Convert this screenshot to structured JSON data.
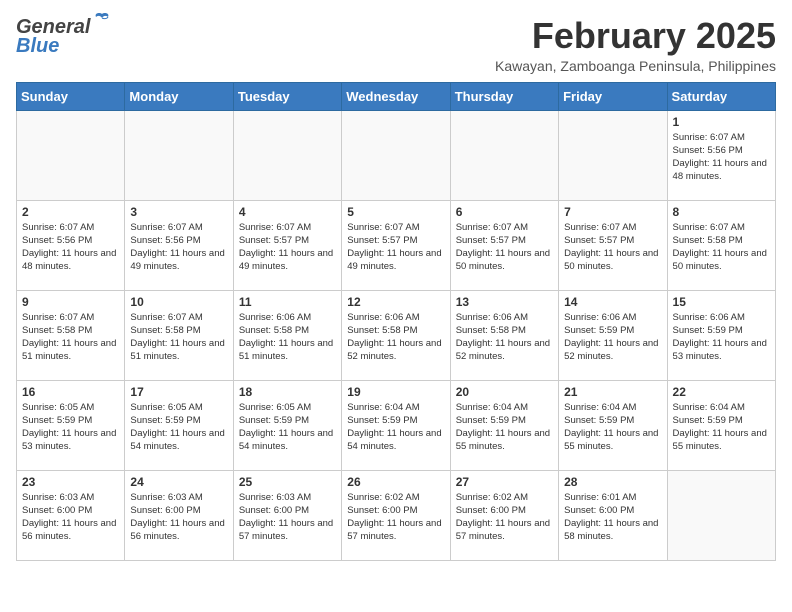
{
  "header": {
    "logo_general": "General",
    "logo_blue": "Blue",
    "month_year": "February 2025",
    "location": "Kawayan, Zamboanga Peninsula, Philippines"
  },
  "weekdays": [
    "Sunday",
    "Monday",
    "Tuesday",
    "Wednesday",
    "Thursday",
    "Friday",
    "Saturday"
  ],
  "weeks": [
    [
      {
        "day": "",
        "info": ""
      },
      {
        "day": "",
        "info": ""
      },
      {
        "day": "",
        "info": ""
      },
      {
        "day": "",
        "info": ""
      },
      {
        "day": "",
        "info": ""
      },
      {
        "day": "",
        "info": ""
      },
      {
        "day": "1",
        "info": "Sunrise: 6:07 AM\nSunset: 5:56 PM\nDaylight: 11 hours and 48 minutes."
      }
    ],
    [
      {
        "day": "2",
        "info": "Sunrise: 6:07 AM\nSunset: 5:56 PM\nDaylight: 11 hours and 48 minutes."
      },
      {
        "day": "3",
        "info": "Sunrise: 6:07 AM\nSunset: 5:56 PM\nDaylight: 11 hours and 49 minutes."
      },
      {
        "day": "4",
        "info": "Sunrise: 6:07 AM\nSunset: 5:57 PM\nDaylight: 11 hours and 49 minutes."
      },
      {
        "day": "5",
        "info": "Sunrise: 6:07 AM\nSunset: 5:57 PM\nDaylight: 11 hours and 49 minutes."
      },
      {
        "day": "6",
        "info": "Sunrise: 6:07 AM\nSunset: 5:57 PM\nDaylight: 11 hours and 50 minutes."
      },
      {
        "day": "7",
        "info": "Sunrise: 6:07 AM\nSunset: 5:57 PM\nDaylight: 11 hours and 50 minutes."
      },
      {
        "day": "8",
        "info": "Sunrise: 6:07 AM\nSunset: 5:58 PM\nDaylight: 11 hours and 50 minutes."
      }
    ],
    [
      {
        "day": "9",
        "info": "Sunrise: 6:07 AM\nSunset: 5:58 PM\nDaylight: 11 hours and 51 minutes."
      },
      {
        "day": "10",
        "info": "Sunrise: 6:07 AM\nSunset: 5:58 PM\nDaylight: 11 hours and 51 minutes."
      },
      {
        "day": "11",
        "info": "Sunrise: 6:06 AM\nSunset: 5:58 PM\nDaylight: 11 hours and 51 minutes."
      },
      {
        "day": "12",
        "info": "Sunrise: 6:06 AM\nSunset: 5:58 PM\nDaylight: 11 hours and 52 minutes."
      },
      {
        "day": "13",
        "info": "Sunrise: 6:06 AM\nSunset: 5:58 PM\nDaylight: 11 hours and 52 minutes."
      },
      {
        "day": "14",
        "info": "Sunrise: 6:06 AM\nSunset: 5:59 PM\nDaylight: 11 hours and 52 minutes."
      },
      {
        "day": "15",
        "info": "Sunrise: 6:06 AM\nSunset: 5:59 PM\nDaylight: 11 hours and 53 minutes."
      }
    ],
    [
      {
        "day": "16",
        "info": "Sunrise: 6:05 AM\nSunset: 5:59 PM\nDaylight: 11 hours and 53 minutes."
      },
      {
        "day": "17",
        "info": "Sunrise: 6:05 AM\nSunset: 5:59 PM\nDaylight: 11 hours and 54 minutes."
      },
      {
        "day": "18",
        "info": "Sunrise: 6:05 AM\nSunset: 5:59 PM\nDaylight: 11 hours and 54 minutes."
      },
      {
        "day": "19",
        "info": "Sunrise: 6:04 AM\nSunset: 5:59 PM\nDaylight: 11 hours and 54 minutes."
      },
      {
        "day": "20",
        "info": "Sunrise: 6:04 AM\nSunset: 5:59 PM\nDaylight: 11 hours and 55 minutes."
      },
      {
        "day": "21",
        "info": "Sunrise: 6:04 AM\nSunset: 5:59 PM\nDaylight: 11 hours and 55 minutes."
      },
      {
        "day": "22",
        "info": "Sunrise: 6:04 AM\nSunset: 5:59 PM\nDaylight: 11 hours and 55 minutes."
      }
    ],
    [
      {
        "day": "23",
        "info": "Sunrise: 6:03 AM\nSunset: 6:00 PM\nDaylight: 11 hours and 56 minutes."
      },
      {
        "day": "24",
        "info": "Sunrise: 6:03 AM\nSunset: 6:00 PM\nDaylight: 11 hours and 56 minutes."
      },
      {
        "day": "25",
        "info": "Sunrise: 6:03 AM\nSunset: 6:00 PM\nDaylight: 11 hours and 57 minutes."
      },
      {
        "day": "26",
        "info": "Sunrise: 6:02 AM\nSunset: 6:00 PM\nDaylight: 11 hours and 57 minutes."
      },
      {
        "day": "27",
        "info": "Sunrise: 6:02 AM\nSunset: 6:00 PM\nDaylight: 11 hours and 57 minutes."
      },
      {
        "day": "28",
        "info": "Sunrise: 6:01 AM\nSunset: 6:00 PM\nDaylight: 11 hours and 58 minutes."
      },
      {
        "day": "",
        "info": ""
      }
    ]
  ]
}
